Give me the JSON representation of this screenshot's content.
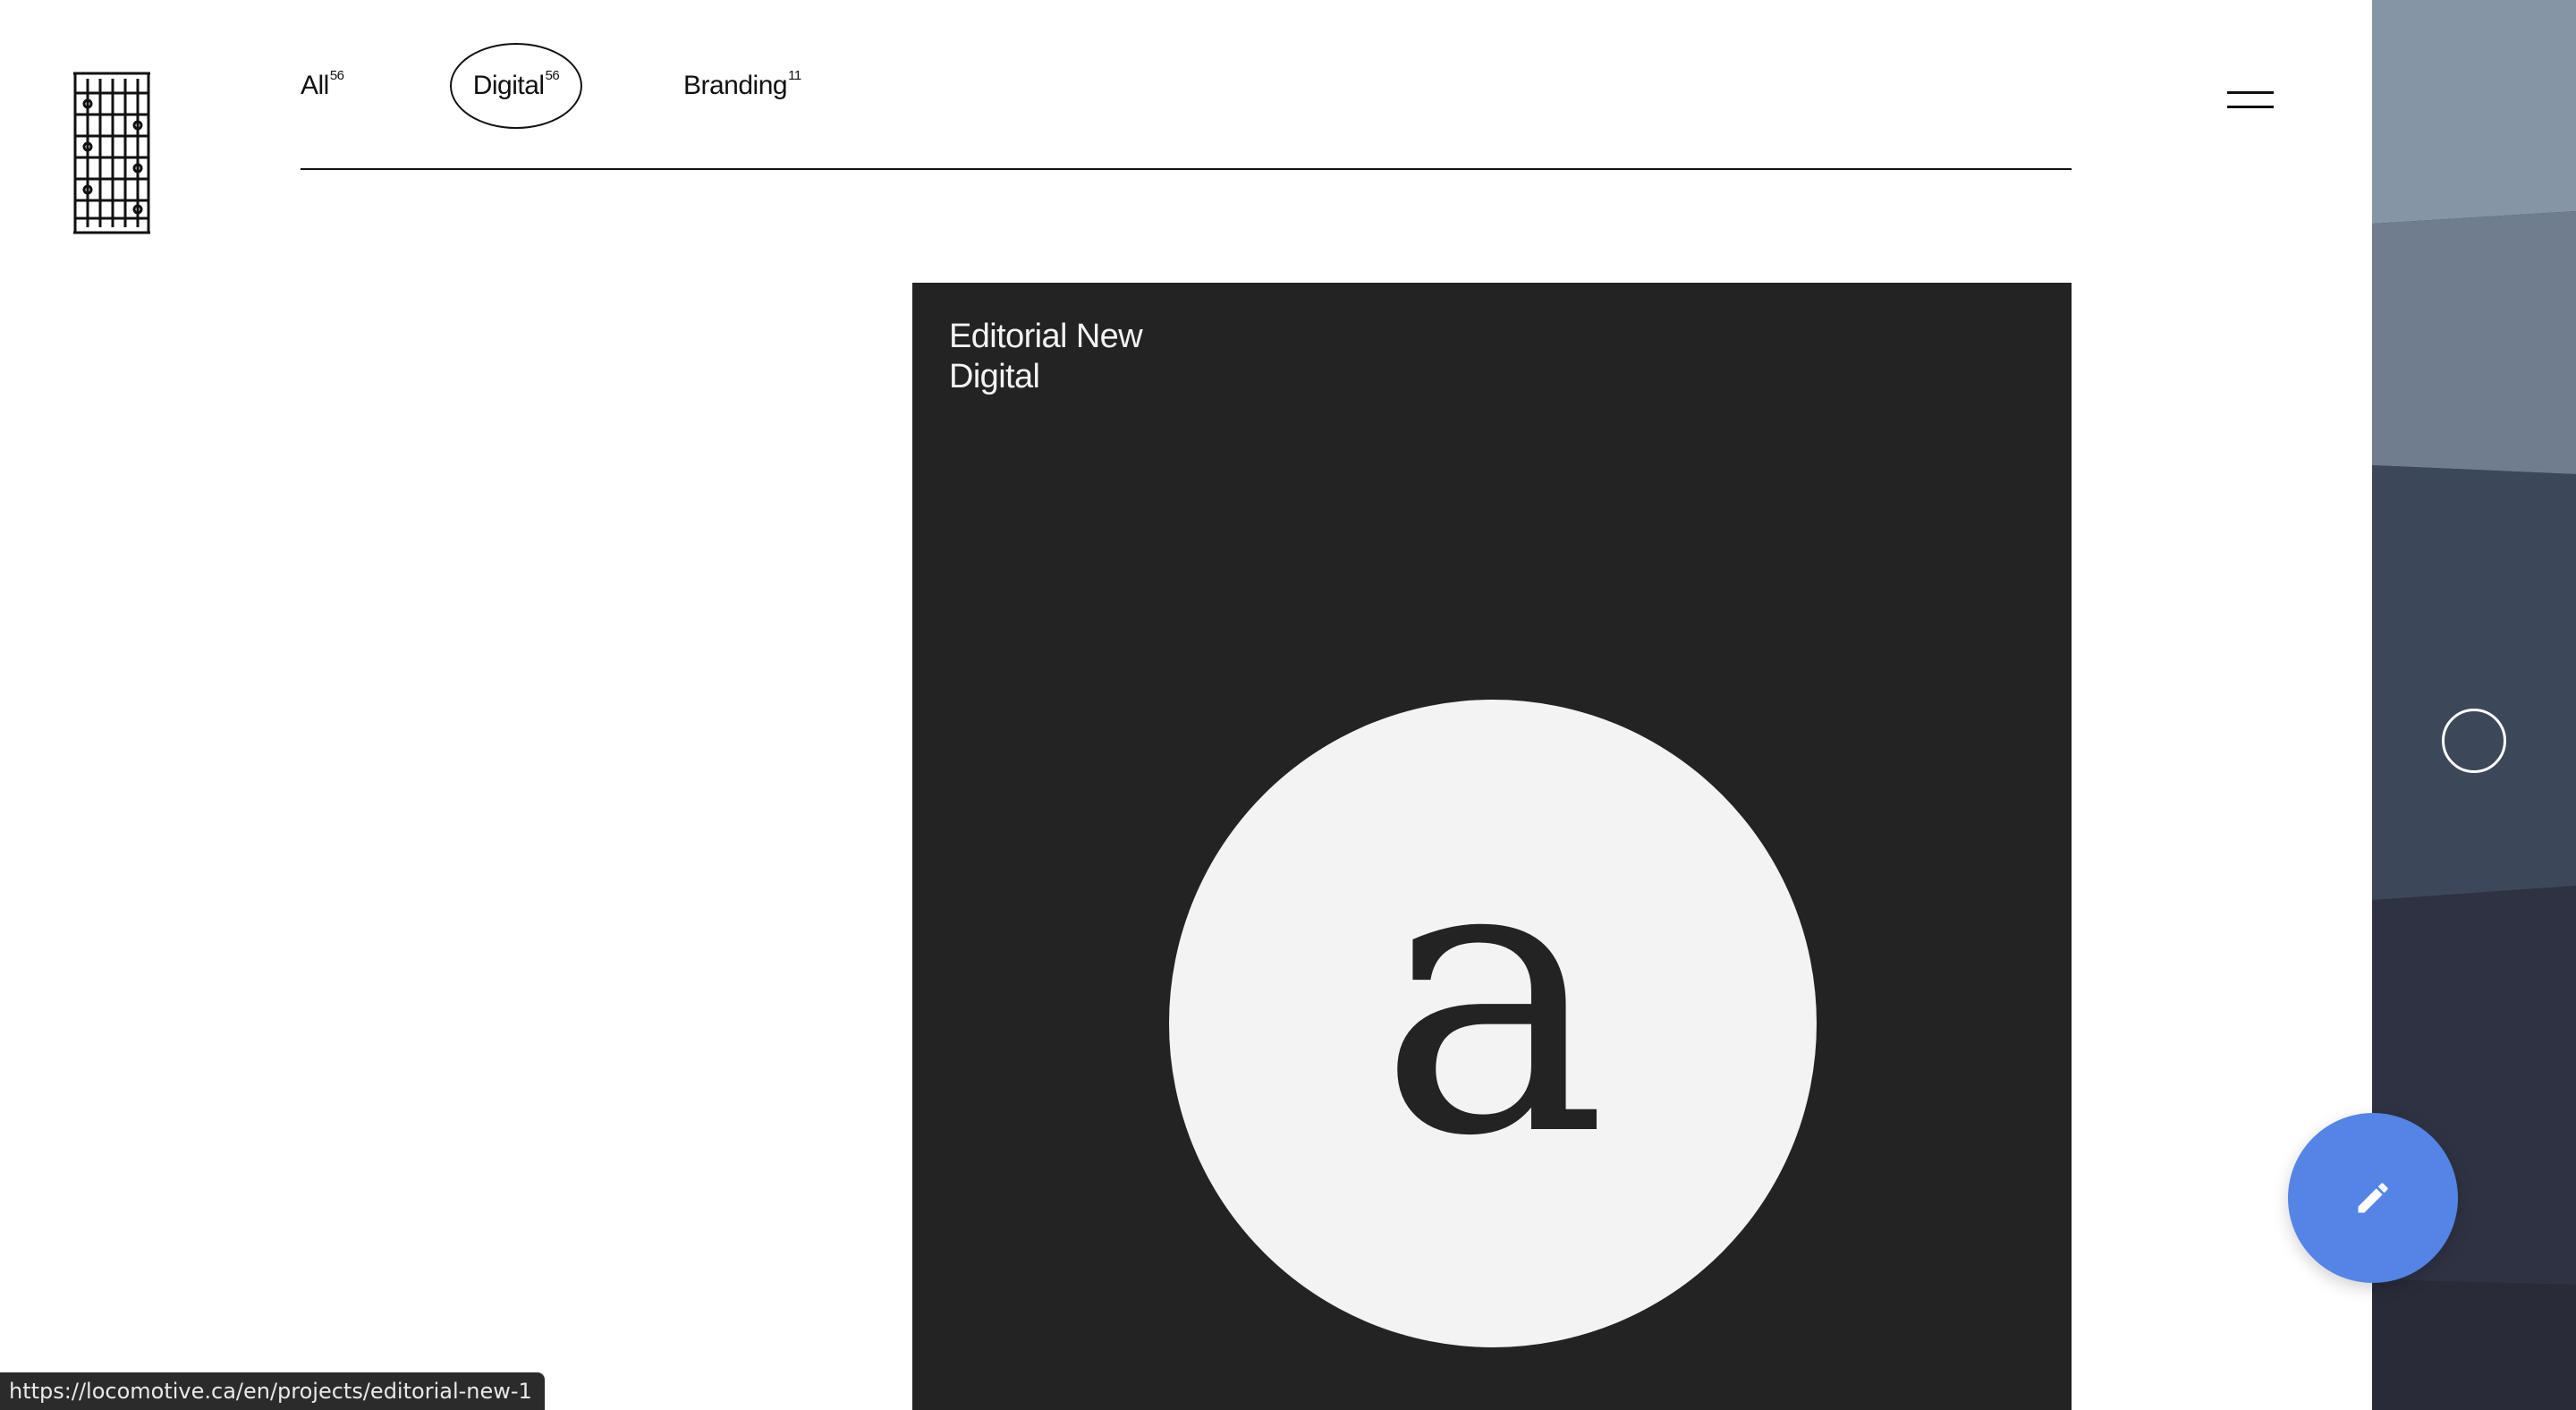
{
  "logo": {
    "icon": "locomotive-logo-icon"
  },
  "filters": [
    {
      "label": "All",
      "count": "56",
      "active": false
    },
    {
      "label": "Digital",
      "count": "56",
      "active": true
    },
    {
      "label": "Branding",
      "count": "11",
      "active": false
    }
  ],
  "menu": {
    "icon": "hamburger-menu-icon"
  },
  "project": {
    "title": "Editorial New",
    "category": "Digital",
    "glyph": "a"
  },
  "fab": {
    "icon": "pencil-icon",
    "color": "#5484e6"
  },
  "status_bar": {
    "url": "https://locomotive.ca/en/projects/editorial-new-1"
  },
  "colors": {
    "card_background": "#232323",
    "disc": "#f3f3f3",
    "text": "#111111"
  }
}
